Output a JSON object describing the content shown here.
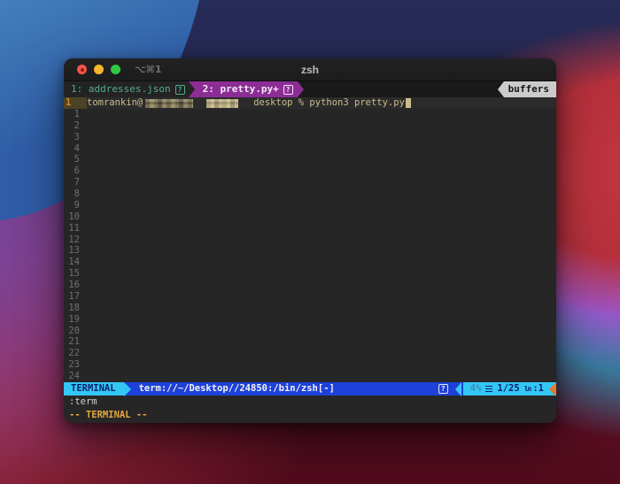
{
  "window": {
    "titlebar": {
      "shortcut": "⌥⌘1",
      "title": "zsh"
    },
    "tabline": {
      "tab1_label": "1: addresses.json",
      "tab1_badge": "?",
      "tab2_label": "2: pretty.py+",
      "tab2_badge": "?",
      "right_label": "buffers"
    },
    "terminal": {
      "current_line_number": "1",
      "prompt_user": "tomrankin@",
      "prompt_command": "desktop % python3 pretty.py",
      "relative_numbers": [
        1,
        2,
        3,
        4,
        5,
        6,
        7,
        8,
        9,
        10,
        11,
        12,
        13,
        14,
        15,
        16,
        17,
        18,
        19,
        20,
        21,
        22,
        23,
        24
      ]
    },
    "statusline": {
      "mode": "TERMINAL",
      "buffer_name": "term://~/Desktop//24850:/bin/zsh[-]",
      "help_badge": "?",
      "scroll_percent": "4%",
      "position": "1/25",
      "line_label": "ln",
      "line_value": ":1"
    },
    "cmdline": ":term",
    "modeline": "-- TERMINAL --"
  },
  "colors": {
    "accent_cyan": "#33c7f6",
    "accent_blue": "#1e41da",
    "accent_magenta": "#8c2d96",
    "accent_orange": "#e8772a",
    "text_tan": "#cbbc8e",
    "current_line_orange": "#d4881c",
    "terminal_bg": "#262626"
  }
}
